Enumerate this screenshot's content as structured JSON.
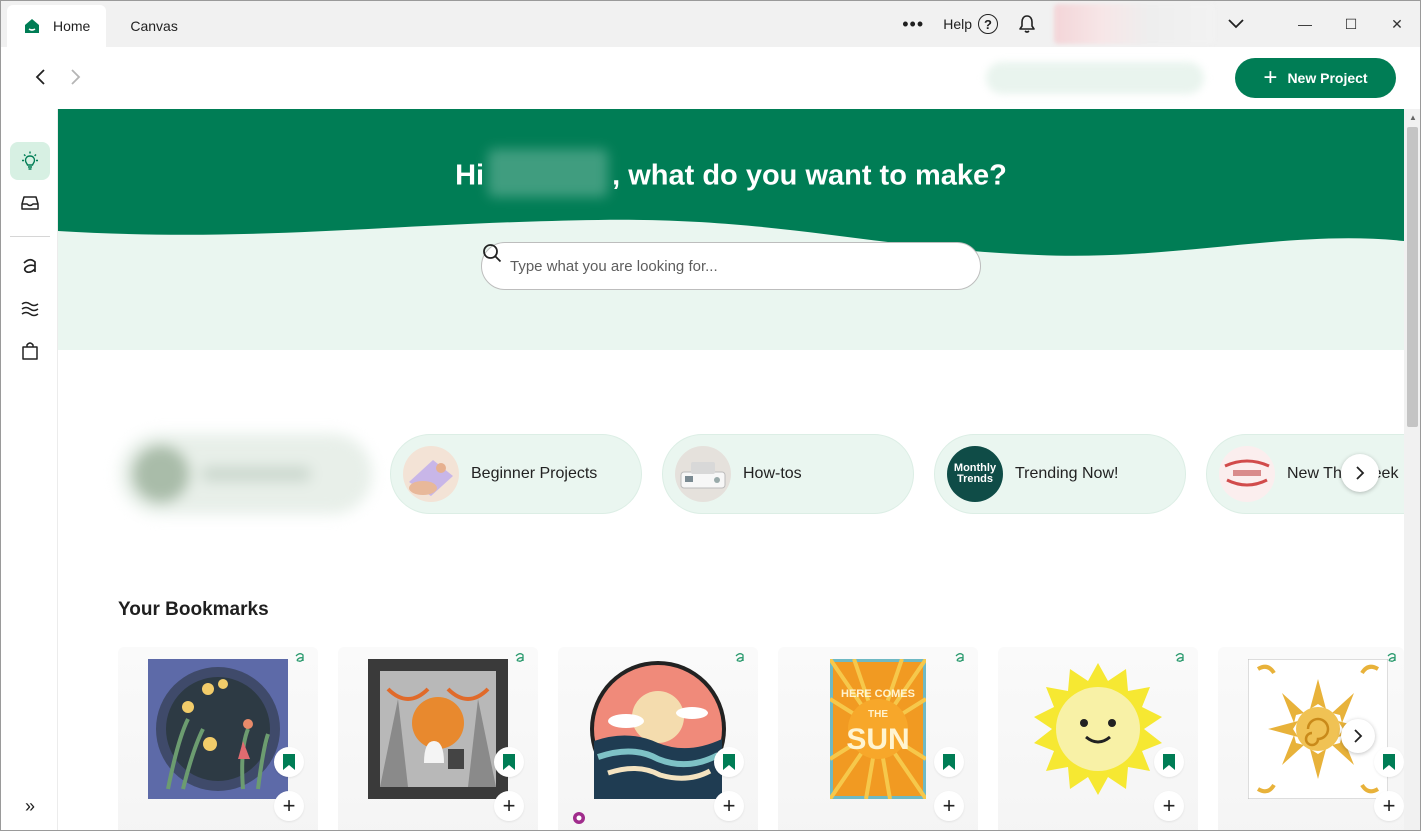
{
  "titlebar": {
    "tabs": [
      {
        "label": "Home",
        "icon": "home-icon",
        "active": true
      },
      {
        "label": "Canvas",
        "active": false
      }
    ],
    "more_label": "•••",
    "help_label": "Help",
    "window_controls": {
      "minimize": "—",
      "maximize": "☐",
      "close": "✕"
    }
  },
  "toolbar": {
    "new_project_label": "New Project"
  },
  "hero": {
    "greeting_prefix": "Hi",
    "greeting_suffix": ", what do you want to make?",
    "search_placeholder": "Type what you are looking for..."
  },
  "rail": {
    "items": [
      {
        "icon": "lightbulb-icon",
        "active": true
      },
      {
        "icon": "inbox-icon"
      },
      {
        "icon": "access-icon"
      },
      {
        "icon": "waves-icon"
      },
      {
        "icon": "shopping-bag-icon"
      },
      {
        "icon": "expand-icon",
        "label": "»"
      }
    ]
  },
  "categories": [
    {
      "label": "",
      "blurred": true
    },
    {
      "label": "Beginner Projects",
      "thumb_icon": "beginner-thumb"
    },
    {
      "label": "How-tos",
      "thumb_icon": "machine-thumb"
    },
    {
      "label": "Trending Now!",
      "thumb_text": "Monthly Trends"
    },
    {
      "label": "New This Week",
      "thumb_icon": "adventure-thumb"
    }
  ],
  "bookmarks": {
    "title": "Your Bookmarks",
    "cards": [
      {
        "art": "fairy-shadowbox"
      },
      {
        "art": "ghost-forest-shadowbox"
      },
      {
        "art": "sunset-waves-circle"
      },
      {
        "art": "here-comes-the-sun-poster",
        "art_text": [
          "HERE COMES",
          "THE",
          "SUN"
        ]
      },
      {
        "art": "smiling-sun"
      },
      {
        "art": "sun-mandala-tile"
      }
    ]
  },
  "colors": {
    "brand_green": "#007d55",
    "mint": "#eaf6f0",
    "rail_active": "#d7f0e3"
  }
}
